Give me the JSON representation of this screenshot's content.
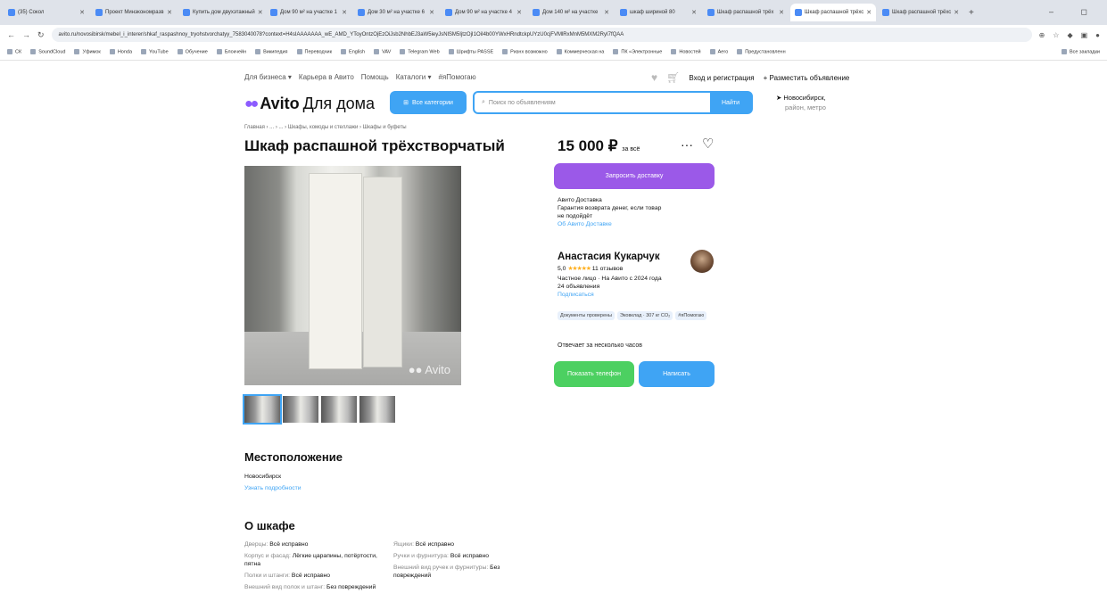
{
  "browser": {
    "tabs": [
      {
        "label": "(35) Сокол"
      },
      {
        "label": "Проект Минэкономразв"
      },
      {
        "label": "Купить дом двухэтажный"
      },
      {
        "label": "Дом 90 м² на участке 1"
      },
      {
        "label": "Дом 30 м² на участке 6"
      },
      {
        "label": "Дом 90 м² на участке 4"
      },
      {
        "label": "Дом 140 м² на участке"
      },
      {
        "label": "шкаф шириной 80"
      },
      {
        "label": "Шкаф распашной трёх"
      },
      {
        "label": "Шкаф распашной трёхс",
        "active": true
      },
      {
        "label": "Шкаф распашной трёхс"
      }
    ],
    "url": "avito.ru/novosibirsk/mebel_i_interer/shkaf_raspashnoy_tryohstvorchatyy_7583040078?context=H4sIAAAAAAA_wE_AMD_YToyOntzOjEzOiJsb2NhbEJ3aW5ieyJsNlSM5IjtzOjI1OiI4b00YWxHRndtckpUYzU0cjFVMlRxMnM5MXM2RyI7fQAA",
    "bookmarks": [
      "СК",
      "SoundCloud",
      "Уфимок",
      "Honda",
      "YouTube",
      "Обучение",
      "Блокчейн",
      "Википедия",
      "Переводчик",
      "English",
      "VAV",
      "Telegram Web",
      "Шрифты PASSE",
      "Ризнх возможно",
      "Коммерческая на",
      "ПК «Электронные",
      "Новостей",
      "Aero",
      "Предустановленн"
    ],
    "bookmarks_right": "Все закладки"
  },
  "topnav": {
    "items": [
      "Для бизнеса ▾",
      "Карьера в Авито",
      "Помощь",
      "Каталоги ▾",
      "#яПомогаю"
    ],
    "login": "Вход и регистрация",
    "post": "+ Разместить объявление"
  },
  "header": {
    "logo_text": "Avito",
    "logo_suffix": "Для дома",
    "categories_btn": "Все категории",
    "search_placeholder": "Поиск по объявлениям",
    "search_btn": "Найти",
    "location": "Новосибирск,",
    "location_sub": "район, метро"
  },
  "breadcrumbs": "Главная › ... › ... › Шкафы, комоды и стеллажи › Шкафы и буфеты",
  "listing": {
    "title": "Шкаф распашной трёхстворчатый",
    "price": "15 000 ₽",
    "price_note": "за всё",
    "photo_watermark": "Avito",
    "thumb_count": 4
  },
  "delivery": {
    "request_btn": "Запросить доставку",
    "title": "Авито Доставка",
    "text": "Гарантия возврата денег, если товар не подойдёт",
    "link": "Об Авито Доставке"
  },
  "seller": {
    "name": "Анастасия Кукарчук",
    "rating": "5,0",
    "stars": "★★★★★",
    "reviews": "11 отзывов",
    "type": "Частное лицо · На Авито с 2024 года",
    "listings": "24 объявления",
    "subscribe": "Подписаться",
    "badges": [
      "Документы проверены",
      "Эковклад · 307 кг CO₂",
      "#яПомогаю"
    ],
    "answers": "Отвечает за несколько часов",
    "phone_btn": "Показать телефон",
    "write_btn": "Написать"
  },
  "location_section": {
    "title": "Местоположение",
    "city": "Новосибирск",
    "link": "Узнать подробности"
  },
  "about": {
    "title": "О шкафе",
    "left": [
      {
        "k": "Дверцы:",
        "v": "Всё исправно"
      },
      {
        "k": "Корпус и фасад:",
        "v": "Лёгкие царапины, потёртости, пятна"
      },
      {
        "k": "Полки и штанги:",
        "v": "Всё исправно"
      },
      {
        "k": "Внешний вид полок и штанг:",
        "v": "Без повреждений"
      }
    ],
    "right": [
      {
        "k": "Ящики:",
        "v": "Всё исправно"
      },
      {
        "k": "Ручки и фурнитура:",
        "v": "Всё исправно"
      },
      {
        "k": "Внешний вид ручек и фурнитуры:",
        "v": "Без повреждений"
      }
    ]
  }
}
